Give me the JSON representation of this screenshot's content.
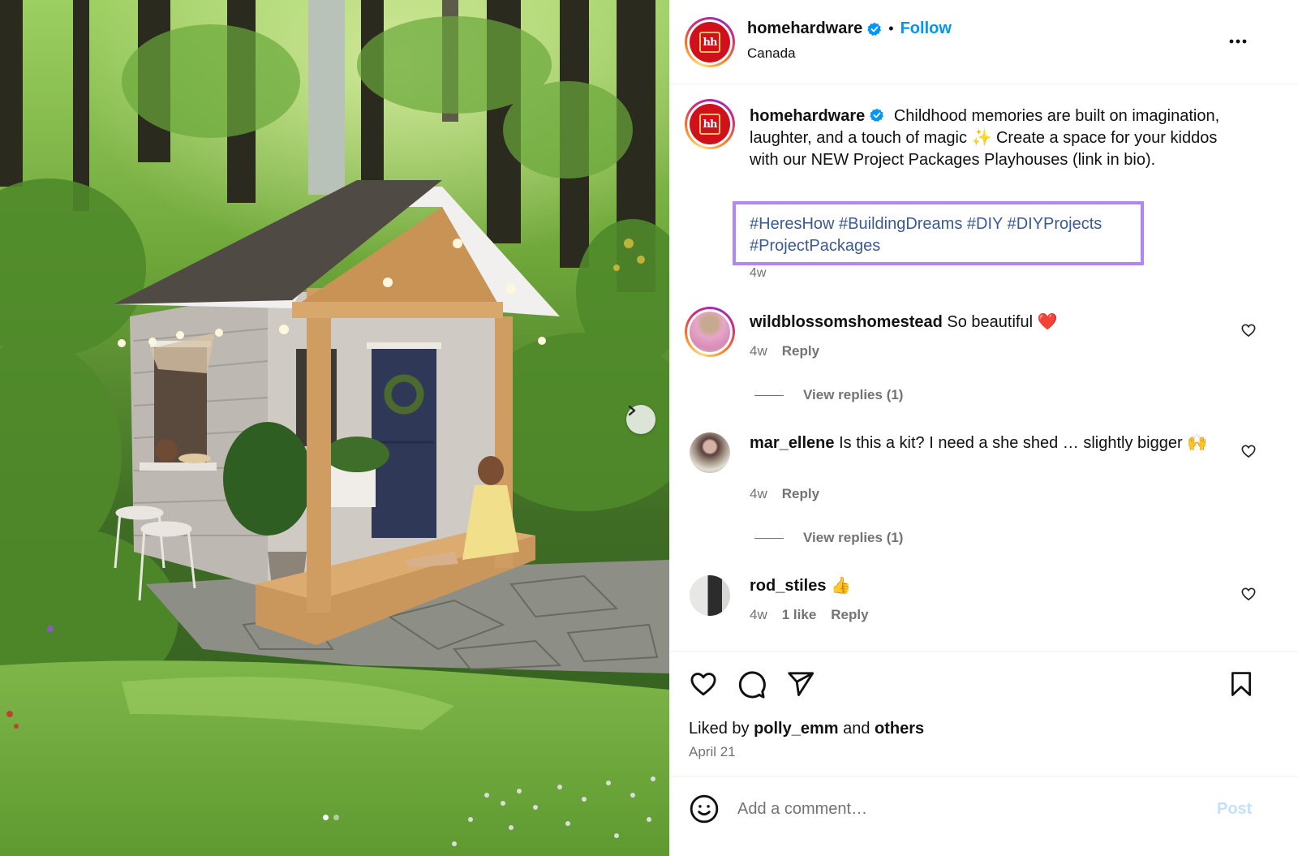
{
  "post": {
    "author": "homehardware",
    "verified": true,
    "follow_label": "Follow",
    "separator": "•",
    "location": "Canada",
    "more_icon": "more-horizontal-icon"
  },
  "caption": {
    "author": "homehardware",
    "text": "Childhood memories are built on imagination, laughter, and a touch of magic ✨ Create a space for your kiddos with our NEW Project Packages Playhouses (link in bio).",
    "hashtags": [
      "#HeresHow",
      "#BuildingDreams",
      "#DIY",
      "#DIYProjects",
      "#ProjectPackages"
    ],
    "highlight_color": "#b385f5",
    "time": "4w"
  },
  "comments": [
    {
      "username": "wildblossomshomestead",
      "text": "So beautiful ❤️",
      "time": "4w",
      "likes": "",
      "reply_label": "Reply",
      "view_replies": "View replies (1)"
    },
    {
      "username": "mar_ellene",
      "text": "Is this a kit? I need a she shed … slightly bigger 🙌",
      "time": "4w",
      "likes": "",
      "reply_label": "Reply",
      "view_replies": "View replies (1)"
    },
    {
      "username": "rod_stiles",
      "text": "👍",
      "time": "4w",
      "likes": "1 like",
      "reply_label": "Reply",
      "view_replies": ""
    }
  ],
  "actions": {
    "like_icon": "heart-icon",
    "comment_icon": "comment-icon",
    "share_icon": "send-icon",
    "save_icon": "bookmark-icon"
  },
  "likes": {
    "prefix": "Liked by",
    "user": "polly_emm",
    "middle": "and",
    "suffix": "others"
  },
  "date": "April 21",
  "add_comment": {
    "placeholder": "Add a comment…",
    "value": "",
    "post_label": "Post"
  },
  "media": {
    "description": "Wooden children's playhouse with grey siding, navy door with wreath, covered porch with string lights, girl reading on porch, forest background",
    "carousel_total": 2,
    "carousel_current": 1
  },
  "colors": {
    "accent": "#0095f6",
    "secondary_text": "#737373",
    "hashtag": "#3a5a96",
    "brand_red": "#d0111b"
  }
}
